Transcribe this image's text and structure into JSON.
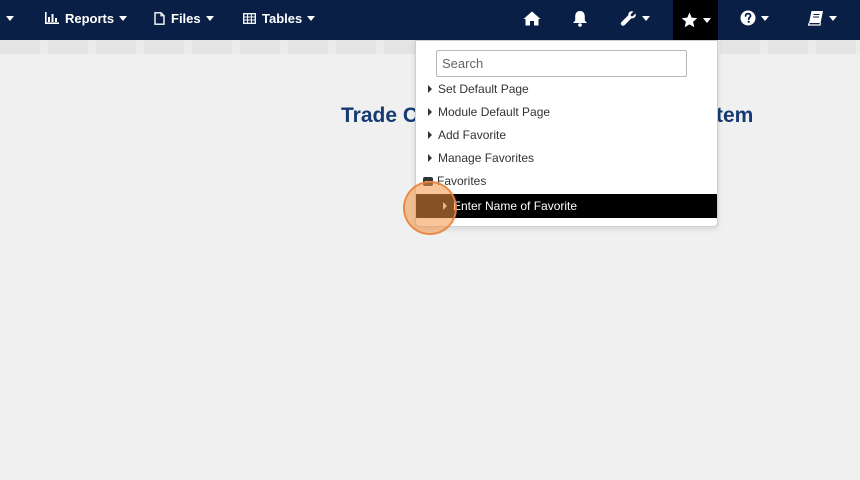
{
  "navbar": {
    "left_items": [
      {
        "label": "Reports",
        "icon": "bar-chart-icon"
      },
      {
        "label": "Files",
        "icon": "file-icon"
      },
      {
        "label": "Tables",
        "icon": "table-icon"
      }
    ],
    "right_icons": [
      "home-icon",
      "bell-icon",
      "wrench-icon",
      "star-icon",
      "question-icon",
      "book-icon"
    ],
    "active_item": "star-icon"
  },
  "page": {
    "title_left": "Trade C",
    "title_right": "tem"
  },
  "favorites_menu": {
    "search_placeholder": "Search",
    "items": [
      {
        "label": "Set Default Page"
      },
      {
        "label": "Module Default Page"
      },
      {
        "label": "Add Favorite"
      },
      {
        "label": "Manage Favorites"
      }
    ],
    "folder_label": "Favorites",
    "entry_label": "Enter Name of Favorite"
  },
  "colors": {
    "navbar": "#0a1f45",
    "title": "#163a72",
    "highlight": "#000000"
  }
}
